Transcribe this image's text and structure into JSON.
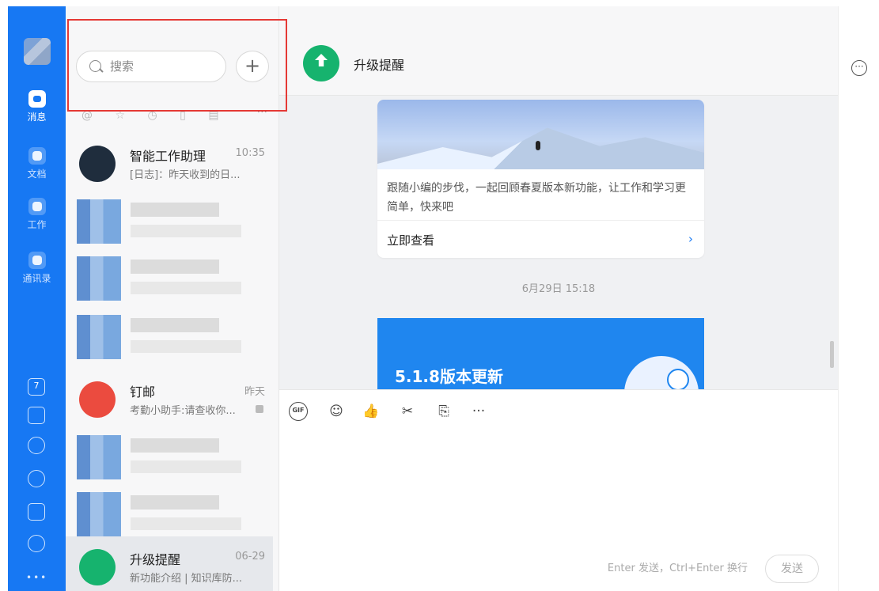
{
  "window": {
    "controls": [
      "—",
      "□",
      "×"
    ]
  },
  "left_nav": {
    "items": [
      {
        "label": "消息",
        "icon": "message-icon",
        "active": true
      },
      {
        "label": "文档",
        "icon": "document-icon",
        "active": false
      },
      {
        "label": "工作",
        "icon": "work-icon",
        "active": false
      },
      {
        "label": "通讯录",
        "icon": "contacts-icon",
        "active": false
      }
    ],
    "bottom_icons": [
      "calendar-icon",
      "task-icon",
      "lightning-icon",
      "call-icon",
      "mail-icon",
      "share-icon",
      "more-icon"
    ],
    "calendar_day": "7",
    "more": "•••"
  },
  "search": {
    "placeholder": "搜索",
    "add": "+"
  },
  "filters": {
    "icons": [
      "@",
      "☆",
      "◷",
      "▯",
      "▤"
    ],
    "more": "···"
  },
  "conversations": [
    {
      "title": "智能工作助理",
      "preview": "[日志]：昨天收到的日...",
      "time": "10:35"
    },
    {
      "title": "钉邮",
      "preview": "考勤小助手:请查收你...",
      "time": "昨天"
    },
    {
      "title": "升级提醒",
      "preview": "新功能介绍 | 知识库防...",
      "time": "06-29"
    }
  ],
  "chat": {
    "title": "升级提醒",
    "card_text": "跟随小编的步伐，一起回顾春夏版本新功能，让工作和学习更简单，快来吧",
    "card_link": "立即查看",
    "timestamp": "6月29日 15:18",
    "update_title": "5.1.8版本更新",
    "tools": [
      "GIF",
      "☺",
      "👍",
      "✂",
      "⎘",
      "···"
    ],
    "hint": "Enter 发送，Ctrl+Enter 换行",
    "send": "发送"
  },
  "right_panel": {
    "more": "···"
  },
  "colors": {
    "accent": "#1778f3",
    "selected": "#e6e8ec",
    "green": "#16b36e",
    "red": "#e53935"
  }
}
